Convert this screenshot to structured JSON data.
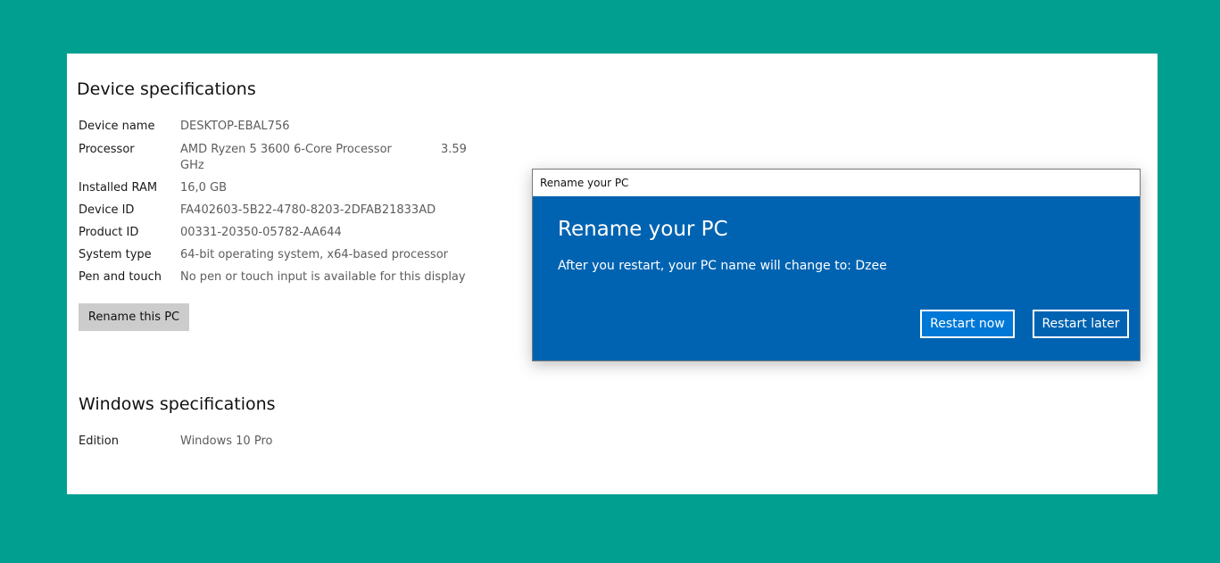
{
  "device_specs": {
    "title": "Device specifications",
    "rows": [
      {
        "label": "Device name",
        "value": "DESKTOP-EBAL756"
      },
      {
        "label": "Processor",
        "value": "AMD Ryzen 5 3600 6-Core Processor GHz",
        "extra": "3.59"
      },
      {
        "label": "Installed RAM",
        "value": "16,0 GB"
      },
      {
        "label": "Device ID",
        "value": "FA402603-5B22-4780-8203-2DFAB21833AD"
      },
      {
        "label": "Product ID",
        "value": "00331-20350-05782-AA644"
      },
      {
        "label": "System type",
        "value": "64-bit operating system, x64-based processor"
      },
      {
        "label": "Pen and touch",
        "value": "No pen or touch input is available for this display"
      }
    ],
    "rename_button": "Rename this PC"
  },
  "windows_specs": {
    "title": "Windows specifications",
    "rows": [
      {
        "label": "Edition",
        "value": "Windows 10 Pro"
      }
    ]
  },
  "dialog": {
    "window_title": "Rename your PC",
    "heading": "Rename your PC",
    "message": "After you restart, your PC name will change to: Dzee",
    "restart_now": "Restart now",
    "restart_later": "Restart later"
  },
  "colors": {
    "background": "#009f90",
    "dialog_blue": "#0063b1",
    "accent_button": "#0078d7"
  }
}
